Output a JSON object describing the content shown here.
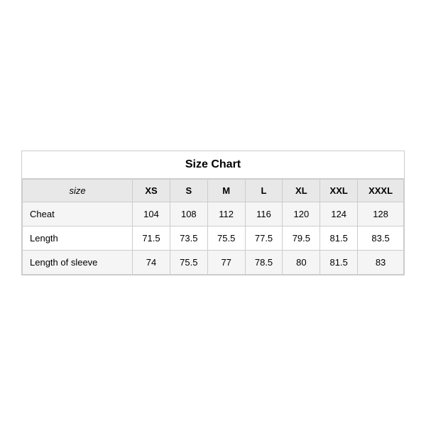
{
  "chart": {
    "title": "Size Chart",
    "headers": {
      "size_label": "size",
      "columns": [
        "XS",
        "S",
        "M",
        "L",
        "XL",
        "XXL",
        "XXXL"
      ]
    },
    "rows": [
      {
        "label": "Cheat",
        "values": [
          "104",
          "108",
          "112",
          "116",
          "120",
          "124",
          "128"
        ]
      },
      {
        "label": "Length",
        "values": [
          "71.5",
          "73.5",
          "75.5",
          "77.5",
          "79.5",
          "81.5",
          "83.5"
        ]
      },
      {
        "label": "Length of sleeve",
        "values": [
          "74",
          "75.5",
          "77",
          "78.5",
          "80",
          "81.5",
          "83"
        ]
      }
    ]
  }
}
